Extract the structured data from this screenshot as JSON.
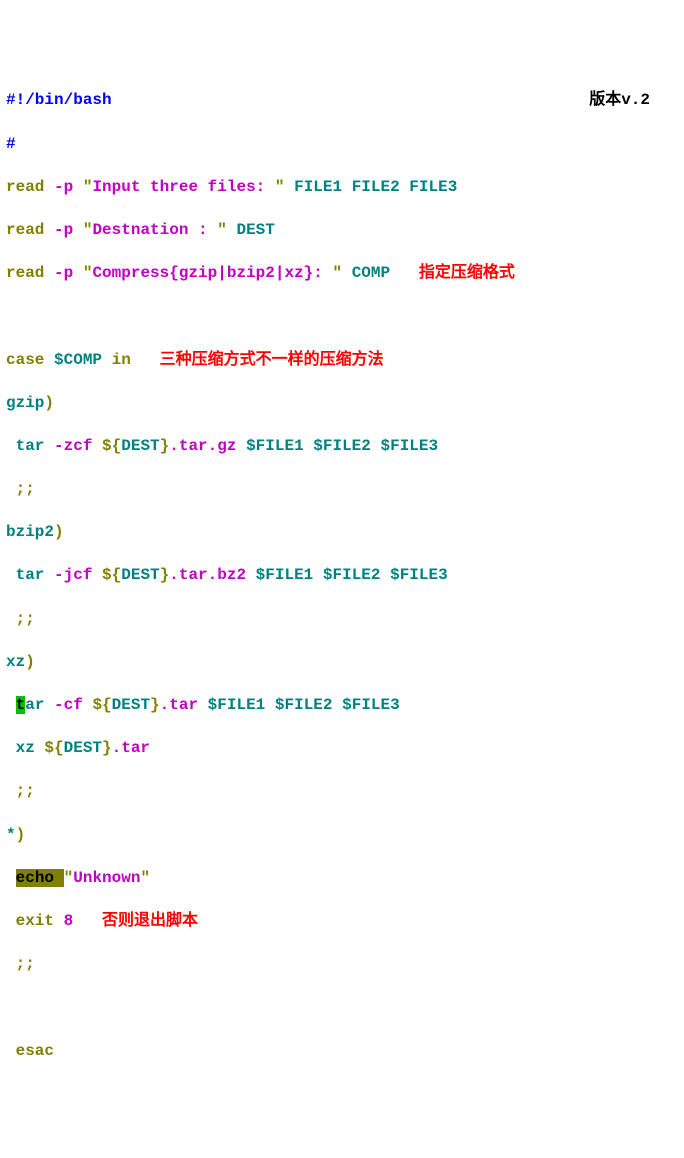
{
  "version_label": "版本v.2",
  "l1": {
    "a": "#!/bin/bash"
  },
  "l2": {
    "a": "#"
  },
  "l3": {
    "a": "read ",
    "b": "-p ",
    "c": "\"",
    "d": "Input three files: ",
    "e": "\"",
    "f": " FILE1 FILE2 FILE3"
  },
  "l4": {
    "a": "read ",
    "b": "-p ",
    "c": "\"",
    "d": "Destnation : ",
    "e": "\"",
    "f": " DEST"
  },
  "l5": {
    "a": "read ",
    "b": "-p ",
    "c": "\"",
    "d": "Compress{gzip|bzip2|xz}: ",
    "e": "\"",
    "f": " COMP",
    "note": "   指定压缩格式"
  },
  "l6": " ",
  "l7": {
    "a": "case ",
    "b": "$COMP ",
    "c": "in",
    "note": "   三种压缩方式不一样的压缩方法"
  },
  "l8": {
    "a": "gzip",
    "b": ")"
  },
  "l9": {
    "a": " tar ",
    "b": "-zcf ",
    "c": "${",
    "d": "DEST",
    "e": "}",
    "f": ".tar.gz ",
    "g": "$FILE1 $FILE2 $FILE3"
  },
  "l10": " ;;",
  "l11": {
    "a": "bzip2",
    "b": ")"
  },
  "l12": {
    "a": " tar ",
    "b": "-jcf ",
    "c": "${",
    "d": "DEST",
    "e": "}",
    "f": ".tar.bz2 ",
    "g": "$FILE1 $FILE2 $FILE3"
  },
  "l13": " ;;",
  "l14": {
    "a": "xz",
    "b": ")"
  },
  "l15": {
    "sp": " ",
    "a": "t",
    "b": "ar ",
    "c": "-cf ",
    "d": "${",
    "e": "DEST",
    "f": "}",
    "g": ".tar ",
    "h": "$FILE1 $FILE2 $FILE3"
  },
  "l16": {
    "a": " xz ",
    "b": "${",
    "c": "DEST",
    "d": "}",
    "e": ".tar"
  },
  "l17": " ;;",
  "l18": {
    "a": "*",
    "b": ")"
  },
  "l19": {
    "sp": " ",
    "a": "echo ",
    "b": "\"",
    "c": "Unknown",
    "d": "\""
  },
  "l20": {
    "a": " exit ",
    "b": "8",
    "note": "   否则退出脚本"
  },
  "l21": " ;;",
  "l22": " ",
  "l23": " esac"
}
